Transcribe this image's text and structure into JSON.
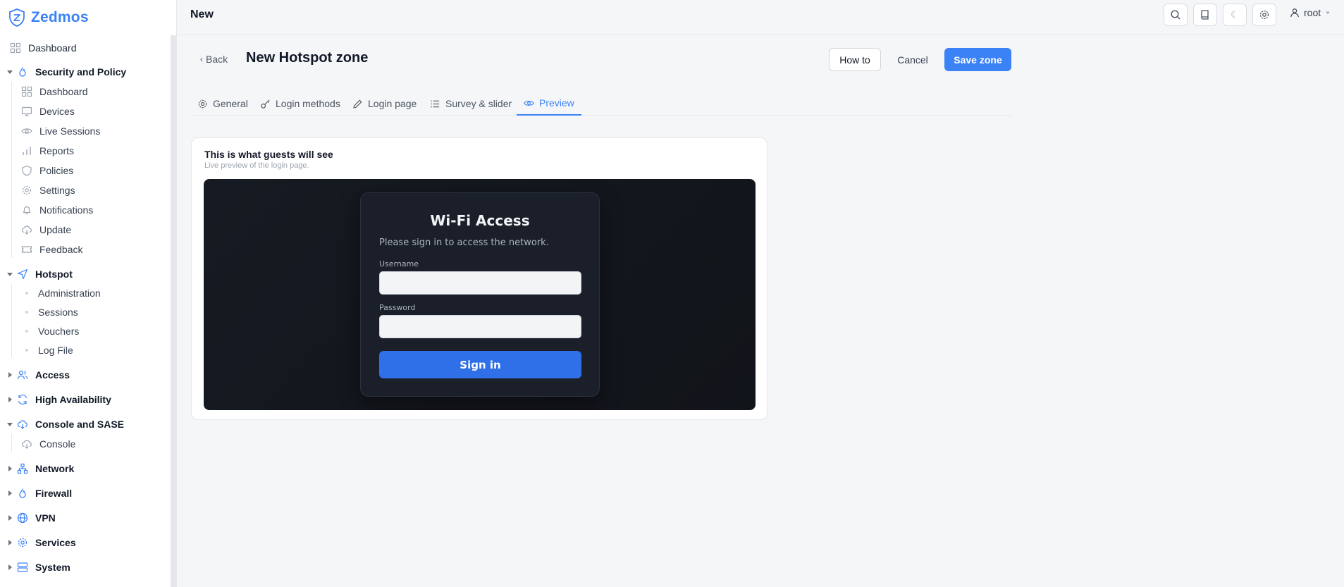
{
  "brand": {
    "name": "Zedmos"
  },
  "sidebar": {
    "top": {
      "label": "Dashboard",
      "icon": "grid-icon"
    },
    "sections": [
      {
        "label": "Security and Policy",
        "expanded": true,
        "items": [
          "Dashboard",
          "Devices",
          "Live Sessions",
          "Reports",
          "Policies",
          "Settings",
          "Notifications",
          "Update",
          "Feedback"
        ]
      },
      {
        "label": "Hotspot",
        "expanded": true,
        "items": [
          "Administration",
          "Sessions",
          "Vouchers",
          "Log File"
        ]
      },
      {
        "label": "Access",
        "expanded": false
      },
      {
        "label": "High Availability",
        "expanded": false
      },
      {
        "label": "Console and SASE",
        "expanded": true,
        "items": [
          "Console"
        ]
      },
      {
        "label": "Network",
        "expanded": false
      },
      {
        "label": "Firewall",
        "expanded": false
      },
      {
        "label": "VPN",
        "expanded": false
      },
      {
        "label": "Services",
        "expanded": false
      },
      {
        "label": "System",
        "expanded": false
      }
    ]
  },
  "topbar": {
    "crumb": "New",
    "icons": [
      "search-icon",
      "book-icon",
      "moon-icon",
      "gear-icon"
    ],
    "theme_glyph": "☾",
    "user": "root"
  },
  "header": {
    "back": "Back",
    "title": "New Hotspot zone",
    "how_to": "How to",
    "cancel": "Cancel",
    "save": "Save zone"
  },
  "tabs": [
    {
      "label": "General",
      "icon": "gear-icon"
    },
    {
      "label": "Login methods",
      "icon": "key-icon"
    },
    {
      "label": "Login page",
      "icon": "pencil-icon"
    },
    {
      "label": "Survey & slider",
      "icon": "list-icon"
    },
    {
      "label": "Preview",
      "icon": "eye-icon",
      "active": true
    }
  ],
  "preview_card": {
    "title": "This is what guests will see",
    "subtitle": "Live preview of the login page.",
    "login": {
      "heading": "Wi-Fi Access",
      "description": "Please sign in to access the network.",
      "username_label": "Username",
      "username_value": "",
      "password_label": "Password",
      "password_value": "",
      "button": "Sign in"
    }
  },
  "colors": {
    "accent": "#3b82f6",
    "preview_bg": "#12161d",
    "signin_button": "#2f6fe8"
  }
}
